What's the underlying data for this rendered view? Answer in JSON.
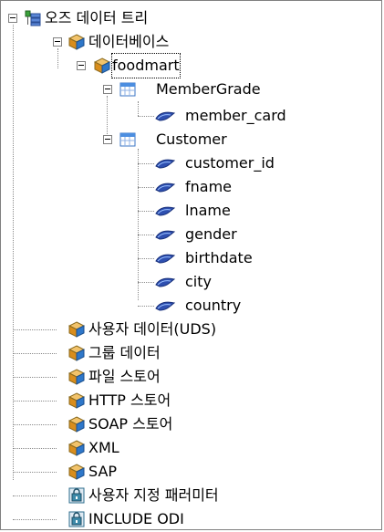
{
  "tree": {
    "root": {
      "label": "오즈 데이터 트리",
      "icon": "tree-root-icon"
    },
    "database": {
      "label": "데이터베이스",
      "icon": "cube-icon"
    },
    "foodmart": {
      "label": "foodmart",
      "icon": "cube-icon",
      "selected": true
    },
    "tables": [
      {
        "label": "MemberGrade",
        "icon": "table-icon",
        "fields": [
          "member_card"
        ]
      },
      {
        "label": "Customer",
        "icon": "table-icon",
        "fields": [
          "customer_id",
          "fname",
          "lname",
          "gender",
          "birthdate",
          "city",
          "country"
        ]
      }
    ],
    "siblings": [
      {
        "label": "사용자 데이터(UDS)",
        "icon": "cube-icon"
      },
      {
        "label": "그룹 데이터",
        "icon": "cube-icon"
      },
      {
        "label": "파일 스토어",
        "icon": "cube-icon"
      },
      {
        "label": "HTTP 스토어",
        "icon": "cube-icon"
      },
      {
        "label": "SOAP 스토어",
        "icon": "cube-icon"
      },
      {
        "label": "XML",
        "icon": "cube-icon"
      },
      {
        "label": "SAP",
        "icon": "cube-icon"
      },
      {
        "label": "사용자 지정 패러미터",
        "icon": "param-box-icon"
      },
      {
        "label": "INCLUDE ODI",
        "icon": "param-box-icon"
      }
    ]
  }
}
